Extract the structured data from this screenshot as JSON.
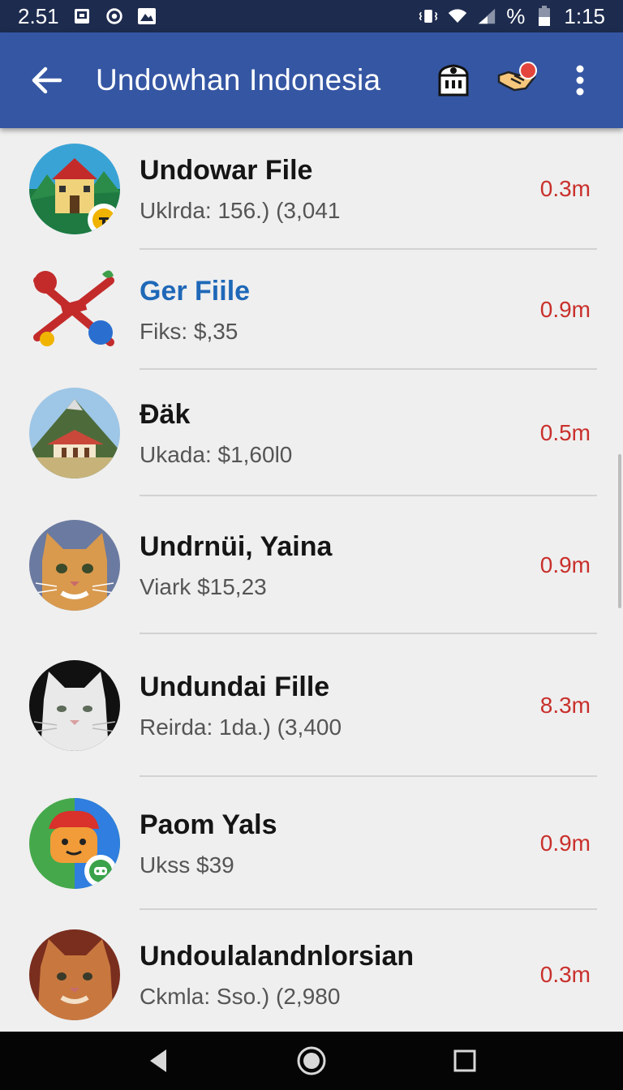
{
  "status_bar": {
    "left_time": "2.51",
    "battery_text": "%",
    "clock": "1:15"
  },
  "app_bar": {
    "title": "Undowhan Indonesia"
  },
  "items": [
    {
      "name": "Undowar File",
      "subtitle": "Uklrda: 156.) (3,041",
      "size": "0.3m"
    },
    {
      "name": "Ger Fiile",
      "subtitle": "Fiks: $,35",
      "size": "0.9m"
    },
    {
      "name": "Ɖäk",
      "subtitle": "Ukada: $1,60l0",
      "size": "0.5m"
    },
    {
      "name": "Undrnüi, Yaina",
      "subtitle": "Viark $15,23",
      "size": "0.9m"
    },
    {
      "name": "Undundai Fille",
      "subtitle": "Reirda: 1da.) (3,400",
      "size": "8.3m"
    },
    {
      "name": "Paom Yals",
      "subtitle": "Ukss $39",
      "size": "0.9m"
    },
    {
      "name": "Undoulalandnlorsian",
      "subtitle": "Ckmla: Sso.) (2,980",
      "size": "0.3m"
    }
  ],
  "colors": {
    "status_bar": "#1d2b4e",
    "app_bar": "#3556a3",
    "size_text": "#c9302c",
    "link_title": "#1f68b8"
  },
  "icons": {
    "back": "arrow-back-icon",
    "store": "store-icon",
    "handshake": "handshake-icon",
    "more": "more-vert-icon"
  }
}
